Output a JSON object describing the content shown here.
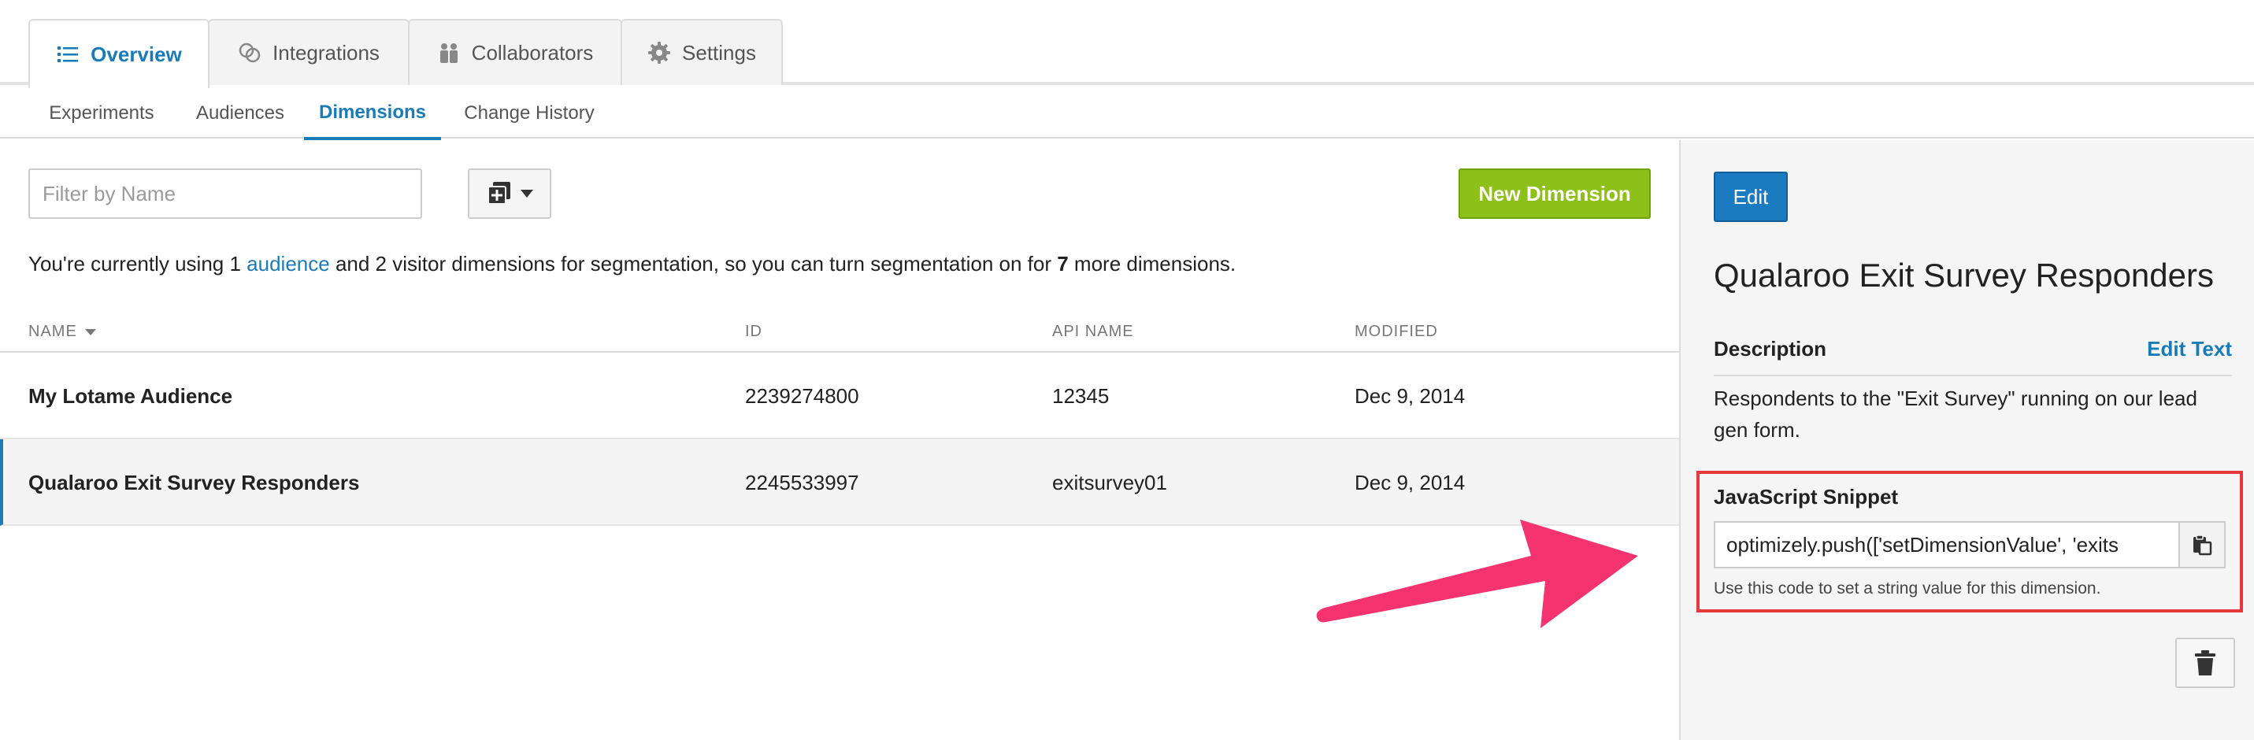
{
  "top_tabs": [
    {
      "label": "Overview",
      "icon": "list-icon",
      "active": true
    },
    {
      "label": "Integrations",
      "icon": "integrations-icon",
      "active": false
    },
    {
      "label": "Collaborators",
      "icon": "collaborators-icon",
      "active": false
    },
    {
      "label": "Settings",
      "icon": "gear-icon",
      "active": false
    }
  ],
  "sub_tabs": [
    {
      "label": "Experiments",
      "active": false
    },
    {
      "label": "Audiences",
      "active": false
    },
    {
      "label": "Dimensions",
      "active": true
    },
    {
      "label": "Change History",
      "active": false
    }
  ],
  "toolbar": {
    "filter_placeholder": "Filter by Name",
    "filter_value": "",
    "new_label": "New Dimension"
  },
  "info": {
    "prefix": "You're currently using 1 ",
    "link": "audience",
    "middle": " and 2 visitor dimensions for segmentation, so you can turn segmentation on for ",
    "count": "7",
    "suffix": " more dimensions."
  },
  "table": {
    "headers": {
      "name": "NAME",
      "id": "ID",
      "api_name": "API NAME",
      "modified": "MODIFIED"
    },
    "rows": [
      {
        "name": "My Lotame Audience",
        "id": "2239274800",
        "api_name": "12345",
        "modified": "Dec 9, 2014"
      },
      {
        "name": "Qualaroo Exit Survey Responders",
        "id": "2245533997",
        "api_name": "exitsurvey01",
        "modified": "Dec 9, 2014"
      }
    ]
  },
  "side": {
    "edit_label": "Edit",
    "title": "Qualaroo Exit Survey Responders",
    "description_label": "Description",
    "edit_text_label": "Edit Text",
    "description": "Respondents to the \"Exit Survey\" running on our lead gen form.",
    "snippet_label": "JavaScript Snippet",
    "snippet_value": "optimizely.push(['setDimensionValue', 'exits",
    "snippet_help": "Use this code to set a string value for this dimension."
  },
  "colors": {
    "accent": "#1a7bb9",
    "new_button": "#8dc11a",
    "highlight_box": "#e8383d",
    "arrow": "#f5336e"
  }
}
